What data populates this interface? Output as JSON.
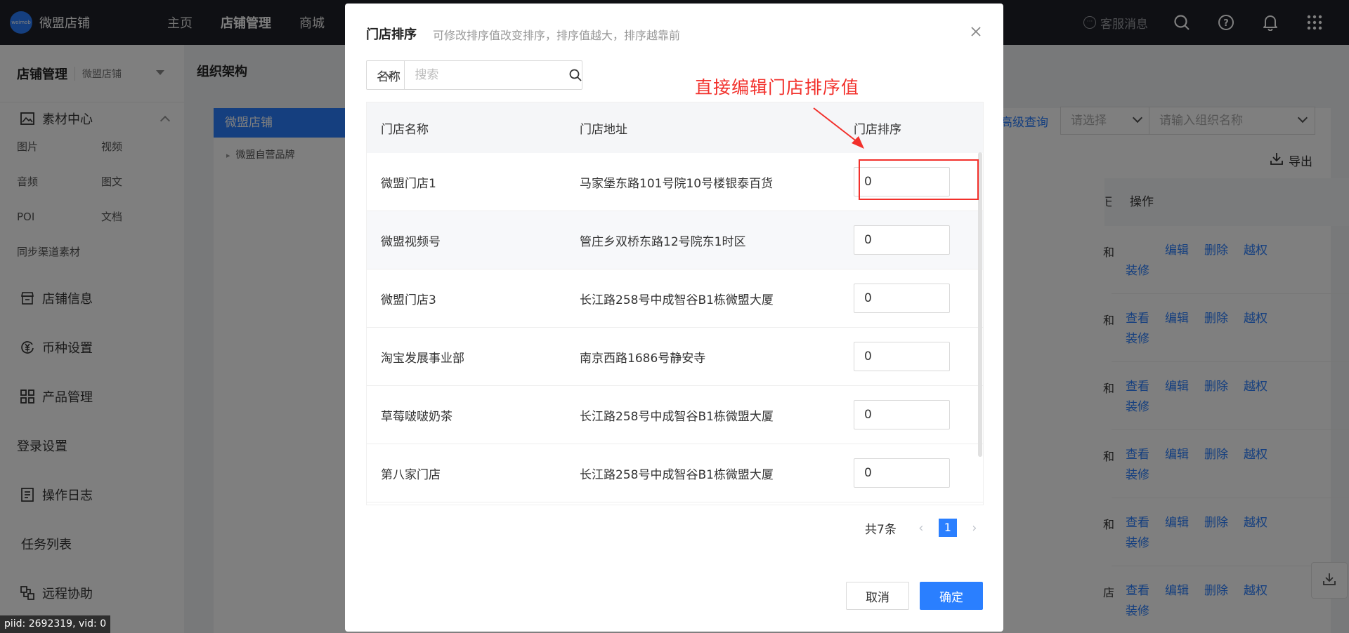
{
  "topbar": {
    "logo_mark": "weimob",
    "app_name": "微盟店铺",
    "nav": [
      "主页",
      "店铺管理",
      "商城"
    ],
    "service": "客服消息"
  },
  "sidebar": {
    "title": "店铺管理",
    "subtitle": "微盟店铺",
    "material": "素材中心",
    "material_items": [
      "图片",
      "视频",
      "音频",
      "图文",
      "POI",
      "文档"
    ],
    "sync": "同步渠道素材",
    "items": [
      "店铺信息",
      "币种设置",
      "产品管理",
      "登录设置",
      "操作日志",
      "任务列表",
      "远程协助"
    ]
  },
  "content": {
    "title": "组织架构",
    "tree_root": "微盟店铺",
    "tree_child": "微盟自营品牌",
    "adv_query": "高级查询",
    "select_placeholder": "请选择",
    "input_placeholder": "请输入组织名称",
    "export": "导出",
    "ops_header": "操作",
    "ops_header_cut": "已",
    "ops_links": [
      "查看",
      "编辑",
      "删除",
      "越权",
      "装修"
    ],
    "row_left": [
      "和",
      "和",
      "和",
      "和",
      "和",
      "店"
    ]
  },
  "modal": {
    "title": "门店排序",
    "subtitle": "可修改排序值改变排序，排序值越大，排序越靠前",
    "search_select": "名称",
    "search_placeholder": "搜索",
    "annotation": "直接编辑门店排序值",
    "columns": [
      "门店名称",
      "门店地址",
      "门店排序"
    ],
    "rows": [
      {
        "name": "微盟门店1",
        "address": "马家堡东路101号院10号楼银泰百货",
        "sort": "0"
      },
      {
        "name": "微盟视频号",
        "address": "管庄乡双桥东路12号院东1时区",
        "sort": "0"
      },
      {
        "name": "微盟门店3",
        "address": "长江路258号中成智谷B1栋微盟大厦",
        "sort": "0"
      },
      {
        "name": "淘宝发展事业部",
        "address": "南京西路1686号静安寺",
        "sort": "0"
      },
      {
        "name": "草莓啵啵奶茶",
        "address": "长江路258号中成智谷B1栋微盟大厦",
        "sort": "0"
      },
      {
        "name": "第八家门店",
        "address": "长江路258号中成智谷B1栋微盟大厦",
        "sort": "0"
      }
    ],
    "total": "共7条",
    "page": "1",
    "cancel": "取消",
    "confirm": "确定"
  },
  "debug": "piid: 2692319, vid: 0",
  "colors": {
    "accent": "#2a7fff",
    "annotation": "#f2302b",
    "topbar": "#1f2129"
  }
}
